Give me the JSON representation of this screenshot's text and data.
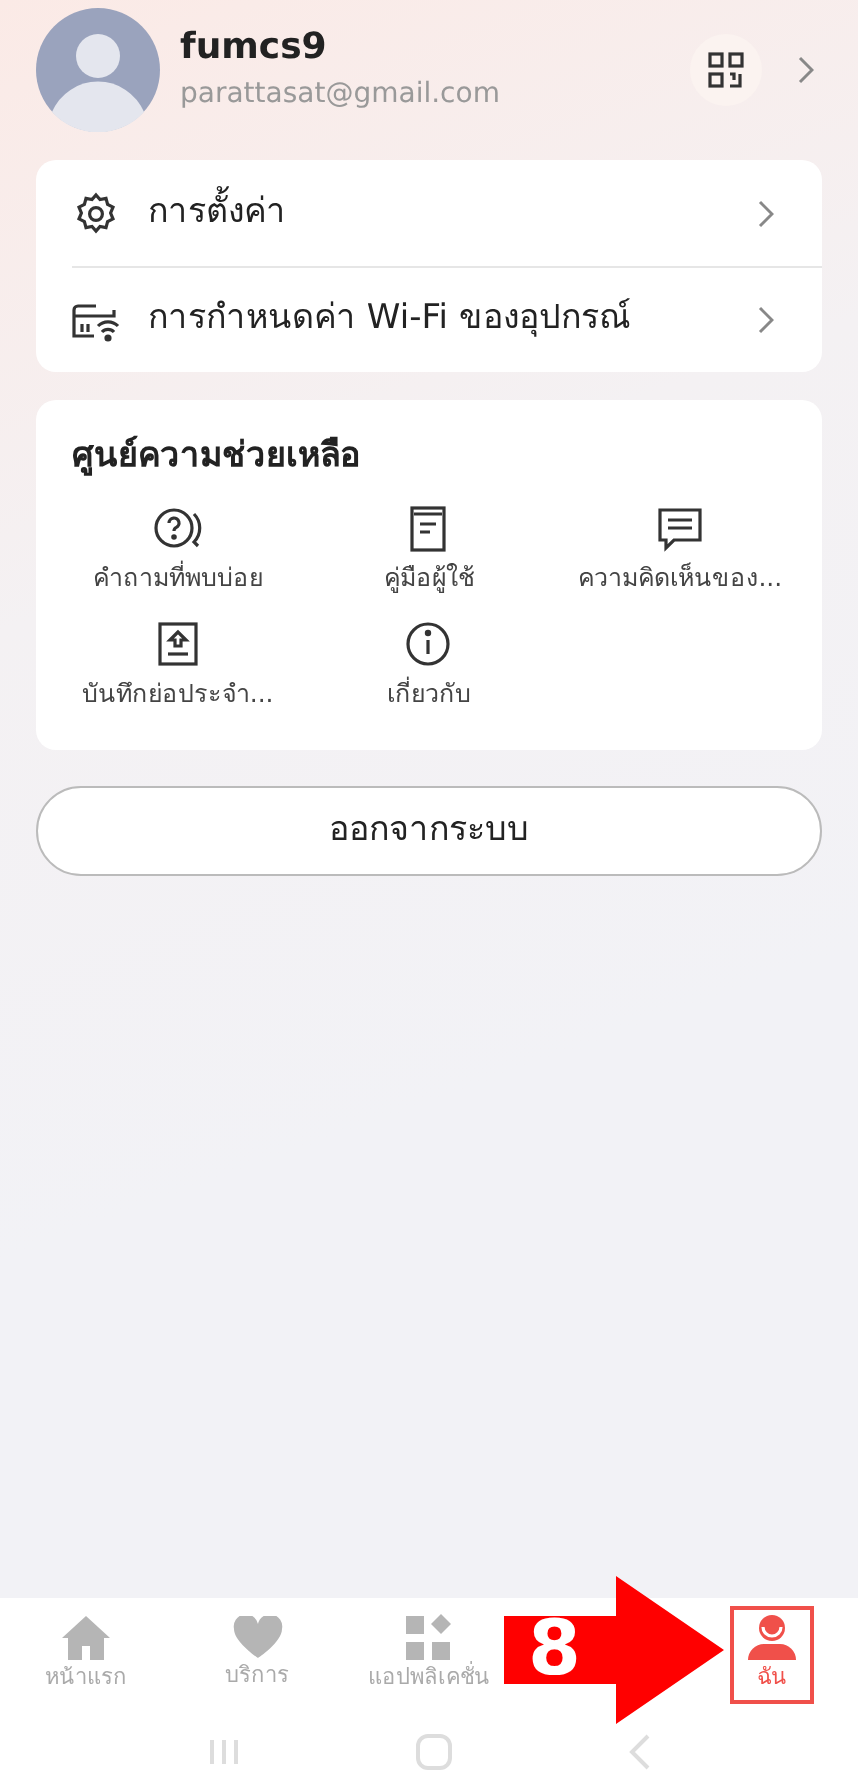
{
  "profile": {
    "name": "fumcs9",
    "email": "parattasat@gmail.com"
  },
  "menu": [
    {
      "kind": "settings",
      "label": "การตั้งค่า"
    },
    {
      "kind": "wifi",
      "label": "การกำหนดค่า Wi-Fi ของอุปกรณ์"
    }
  ],
  "help_center": {
    "title": "ศูนย์ความช่วยเหลือ",
    "items": [
      {
        "kind": "faq",
        "label": "คำถามที่พบบ่อย"
      },
      {
        "kind": "manual",
        "label": "คู่มือผู้ใช้"
      },
      {
        "kind": "feedback",
        "label": "ความคิดเห็นของ..."
      },
      {
        "kind": "log",
        "label": "บันทึกย่อประจำ..."
      },
      {
        "kind": "about",
        "label": "เกี่ยวกับ"
      }
    ]
  },
  "logout": "ออกจากระบบ",
  "tabs": [
    {
      "kind": "home",
      "label": "หน้าแรก",
      "selected": false
    },
    {
      "kind": "services",
      "label": "บริการ",
      "selected": false
    },
    {
      "kind": "apps",
      "label": "แอปพลิเคชั่น",
      "selected": false
    },
    {
      "kind": "hidden"
    },
    {
      "kind": "me",
      "label": "ฉัน",
      "selected": true
    }
  ],
  "annotation": {
    "step": "8"
  }
}
